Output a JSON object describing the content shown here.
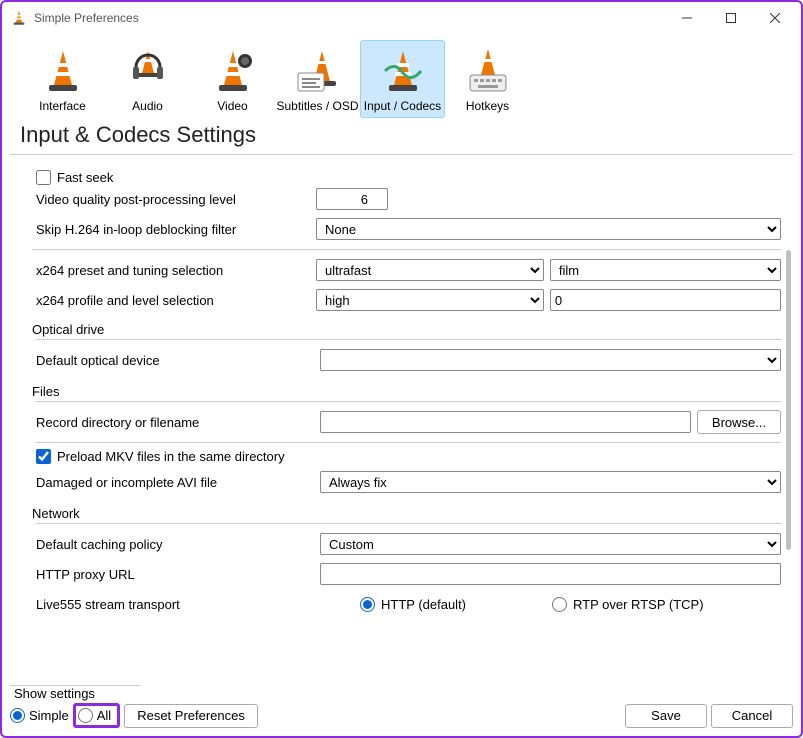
{
  "window": {
    "title": "Simple Preferences"
  },
  "categories": {
    "items": [
      {
        "label": "Interface"
      },
      {
        "label": "Audio"
      },
      {
        "label": "Video"
      },
      {
        "label": "Subtitles / OSD"
      },
      {
        "label": "Input / Codecs"
      },
      {
        "label": "Hotkeys"
      }
    ],
    "selected_index": 4
  },
  "page": {
    "title": "Input & Codecs Settings"
  },
  "codecs": {
    "fast_seek_label": "Fast seek",
    "fast_seek_checked": false,
    "video_quality_label": "Video quality post-processing level",
    "video_quality_value": "6",
    "skip_h264_label": "Skip H.264 in-loop deblocking filter",
    "skip_h264_value": "None",
    "x264_preset_label": "x264 preset and tuning selection",
    "x264_preset_value": "ultrafast",
    "x264_tuning_value": "film",
    "x264_profile_label": "x264 profile and level selection",
    "x264_profile_value": "high",
    "x264_level_value": "0"
  },
  "optical": {
    "legend": "Optical drive",
    "default_device_label": "Default optical device",
    "default_device_value": ""
  },
  "files": {
    "legend": "Files",
    "record_dir_label": "Record directory or filename",
    "record_dir_value": "",
    "browse_label": "Browse...",
    "preload_mkv_label": "Preload MKV files in the same directory",
    "preload_mkv_checked": true,
    "damaged_avi_label": "Damaged or incomplete AVI file",
    "damaged_avi_value": "Always fix"
  },
  "network": {
    "legend": "Network",
    "caching_label": "Default caching policy",
    "caching_value": "Custom",
    "proxy_label": "HTTP proxy URL",
    "proxy_value": "",
    "live555_label": "Live555 stream transport",
    "live555_http_label": "HTTP (default)",
    "live555_rtp_label": "RTP over RTSP (TCP)",
    "live555_selected": "http"
  },
  "bottom": {
    "show_settings_label": "Show settings",
    "simple_label": "Simple",
    "all_label": "All",
    "selected": "simple",
    "reset_label": "Reset Preferences",
    "save_label": "Save",
    "cancel_label": "Cancel"
  }
}
